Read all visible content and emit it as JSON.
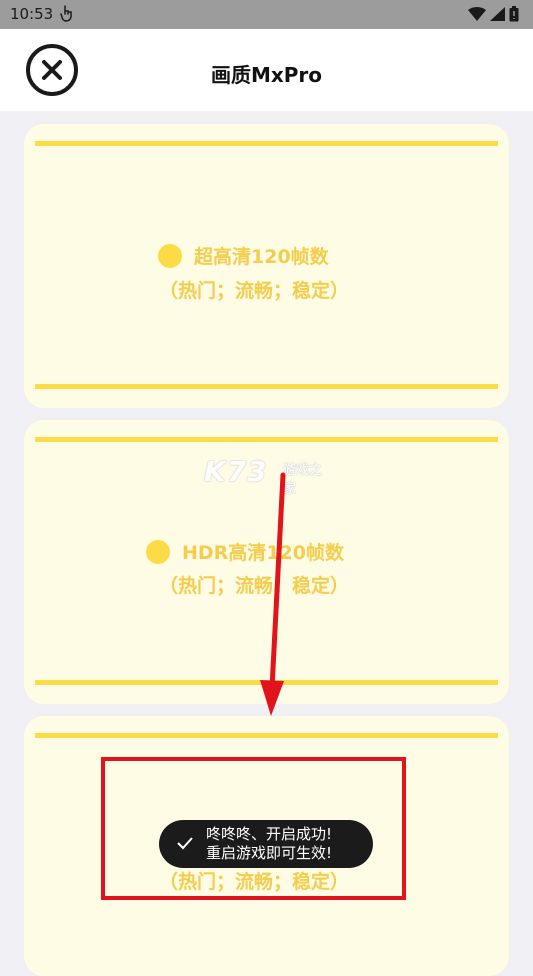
{
  "status_bar": {
    "time": "10:53",
    "icons": [
      "touch-icon",
      "wifi-icon",
      "signal-icon",
      "battery-icon"
    ]
  },
  "header": {
    "title": "画质MxPro",
    "close_icon": "close-circle-icon"
  },
  "options": [
    {
      "label": "超高清120帧数",
      "note": "（热门；流畅；稳定）"
    },
    {
      "label": "HDR高清120帧数",
      "note": "（热门；流畅；稳定）"
    },
    {
      "note": "（热门；流畅；稳定）"
    }
  ],
  "watermark": {
    "brand": "K73",
    "tagline": "游戏之家"
  },
  "toast": {
    "line1": "咚咚咚、开启成功!",
    "line2": "重启游戏即可生效!",
    "icon": "check-icon"
  },
  "colors": {
    "accent_yellow": "#fbdc47",
    "card_bg": "#fffce6",
    "annotation_red": "#e3131b",
    "toast_bg": "#1b1b1b"
  }
}
